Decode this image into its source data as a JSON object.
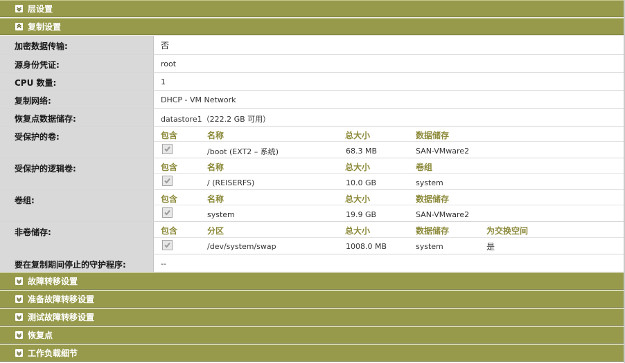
{
  "sections_top": [
    {
      "label": "层设置",
      "state": "collapsed"
    },
    {
      "label": "复制设置",
      "state": "expanded"
    }
  ],
  "fields": {
    "encryption": {
      "label": "加密数据传输:",
      "value": "否"
    },
    "credentials": {
      "label": "源身份凭证:",
      "value": "root"
    },
    "cpu": {
      "label": "CPU 数量:",
      "value": "1"
    },
    "network": {
      "label": "复制网络:",
      "value": "DHCP - VM Network"
    },
    "restore_store": {
      "label": "恢复点数据储存:",
      "value": "datastore1（222.2 GB 可用）"
    },
    "daemons": {
      "label": "要在复制期间停止的守护程序:",
      "value": "--"
    }
  },
  "protected_volumes": {
    "label": "受保护的卷:",
    "headers": [
      "包含",
      "名称",
      "总大小",
      "数据储存"
    ],
    "rows": [
      {
        "checked": true,
        "name": "/boot (EXT2 – 系统)",
        "size": "68.3 MB",
        "store": "SAN-VMware2"
      }
    ]
  },
  "protected_logical_volumes": {
    "label": "受保护的逻辑卷:",
    "headers": [
      "包含",
      "名称",
      "总大小",
      "卷组"
    ],
    "rows": [
      {
        "checked": true,
        "name": "/ (REISERFS)",
        "size": "10.0 GB",
        "store": "system"
      }
    ]
  },
  "volume_groups": {
    "label": "卷组:",
    "headers": [
      "包含",
      "名称",
      "总大小",
      "数据储存"
    ],
    "rows": [
      {
        "checked": true,
        "name": "system",
        "size": "19.9 GB",
        "store": "SAN-VMware2"
      }
    ]
  },
  "non_volume_storage": {
    "label": "非卷储存:",
    "headers": [
      "包含",
      "分区",
      "总大小",
      "数据储存",
      "为交换空间"
    ],
    "rows": [
      {
        "checked": true,
        "name": "/dev/system/swap",
        "size": "1008.0 MB",
        "store": "system",
        "swap": "是"
      }
    ]
  },
  "sections_bottom": [
    {
      "label": "故障转移设置",
      "state": "collapsed"
    },
    {
      "label": "准备故障转移设置",
      "state": "collapsed"
    },
    {
      "label": "测试故障转移设置",
      "state": "collapsed"
    },
    {
      "label": "恢复点",
      "state": "collapsed"
    },
    {
      "label": "工作负载细节",
      "state": "collapsed"
    }
  ],
  "icons": {
    "collapsed": "chevron-down-icon",
    "expanded": "chevron-up-icon",
    "checkbox": "checkmark-icon"
  },
  "colors": {
    "section_bar": "#979a4b",
    "label_bg": "#d9d9d9",
    "column_header": "#8c8a3a"
  }
}
